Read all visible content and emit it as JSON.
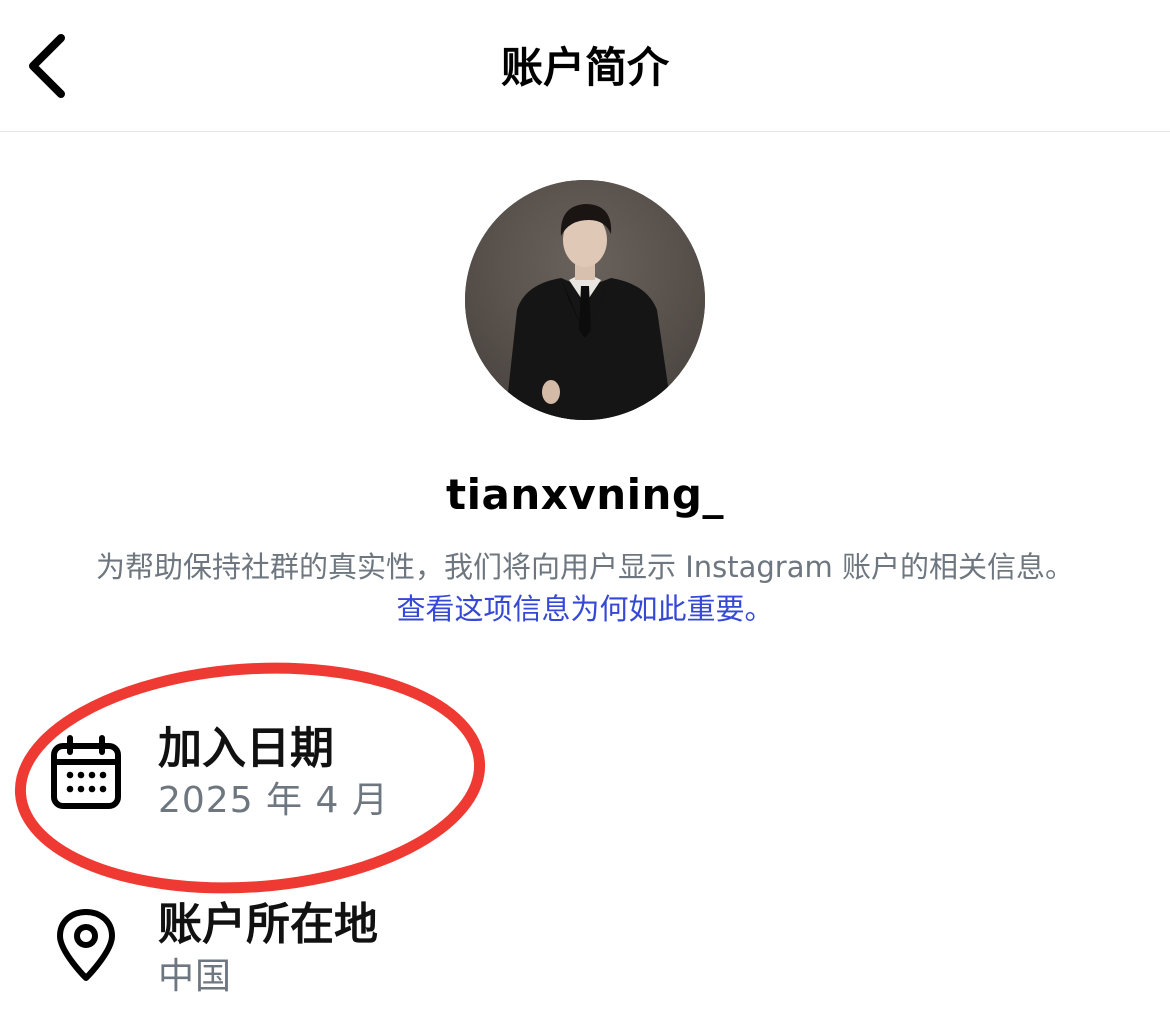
{
  "header": {
    "title": "账户简介",
    "back_icon": "chevron-left-icon"
  },
  "profile": {
    "avatar_icon": "profile-photo",
    "username": "tianxvning_"
  },
  "notice": {
    "text": "为帮助保持社群的真实性，我们将向用户显示 Instagram 账户的相关信息。",
    "link": "查看这项信息为何如此重要。",
    "link_color": "#3648d6"
  },
  "details": [
    {
      "icon": "calendar-icon",
      "label": "加入日期",
      "value": "2025 年 4 月"
    },
    {
      "icon": "location-pin-icon",
      "label": "账户所在地",
      "value": "中国"
    }
  ],
  "annotation": {
    "color": "#ee3a33",
    "shape": "ellipse around join date"
  }
}
